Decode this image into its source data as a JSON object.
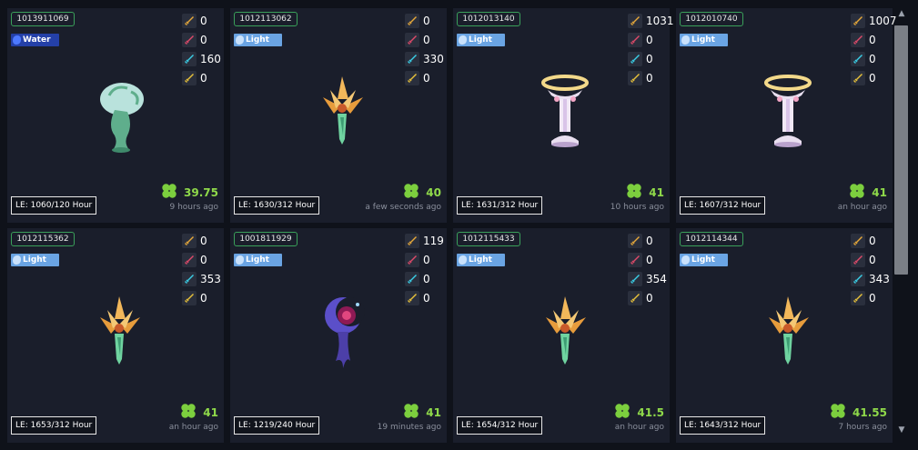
{
  "colors": {
    "background": "#0f121a",
    "card": "#1a1e2b",
    "score_green": "#8fd94a",
    "id_border": "#3aa05a",
    "light_badge": "#6aa4e3",
    "water_badge": "#2440a8"
  },
  "cards": [
    {
      "id": "1013911069",
      "element": "Water",
      "stats": [
        "0",
        "0",
        "160",
        "0"
      ],
      "score": "39.75",
      "time": "9 hours ago",
      "le": "LE: 1060/120 Hour",
      "art": "vase-icon"
    },
    {
      "id": "1012113062",
      "element": "Light",
      "stats": [
        "0",
        "0",
        "330",
        "0"
      ],
      "score": "40",
      "time": "a few seconds ago",
      "le": "LE: 1630/312 Hour",
      "art": "flower-icon"
    },
    {
      "id": "1012013140",
      "element": "Light",
      "stats": [
        "1031",
        "0",
        "0",
        "0"
      ],
      "score": "41",
      "time": "10 hours ago",
      "le": "LE: 1631/312 Hour",
      "art": "halo-pedestal-icon"
    },
    {
      "id": "1012010740",
      "element": "Light",
      "stats": [
        "1007",
        "0",
        "0",
        "0"
      ],
      "score": "41",
      "time": "an hour ago",
      "le": "LE: 1607/312 Hour",
      "art": "halo-pedestal-icon"
    },
    {
      "id": "1012115362",
      "element": "Light",
      "stats": [
        "0",
        "0",
        "353",
        "0"
      ],
      "score": "41",
      "time": "an hour ago",
      "le": "LE: 1653/312 Hour",
      "art": "flower-icon"
    },
    {
      "id": "1001811929",
      "element": "Light",
      "stats": [
        "119",
        "0",
        "0",
        "0"
      ],
      "score": "41",
      "time": "19 minutes ago",
      "le": "LE: 1219/240 Hour",
      "art": "moon-orb-icon"
    },
    {
      "id": "1012115433",
      "element": "Light",
      "stats": [
        "0",
        "0",
        "354",
        "0"
      ],
      "score": "41.5",
      "time": "an hour ago",
      "le": "LE: 1654/312 Hour",
      "art": "flower-icon"
    },
    {
      "id": "1012114344",
      "element": "Light",
      "stats": [
        "0",
        "0",
        "343",
        "0"
      ],
      "score": "41.55",
      "time": "7 hours ago",
      "le": "LE: 1643/312 Hour",
      "art": "flower-icon"
    }
  ],
  "stat_icons": [
    "sword-icon",
    "sword-icon",
    "sword-icon",
    "sword-icon"
  ],
  "stat_icon_colors": [
    "#e8a93a",
    "#e04a6a",
    "#3ad0e8",
    "#e8c23a"
  ]
}
